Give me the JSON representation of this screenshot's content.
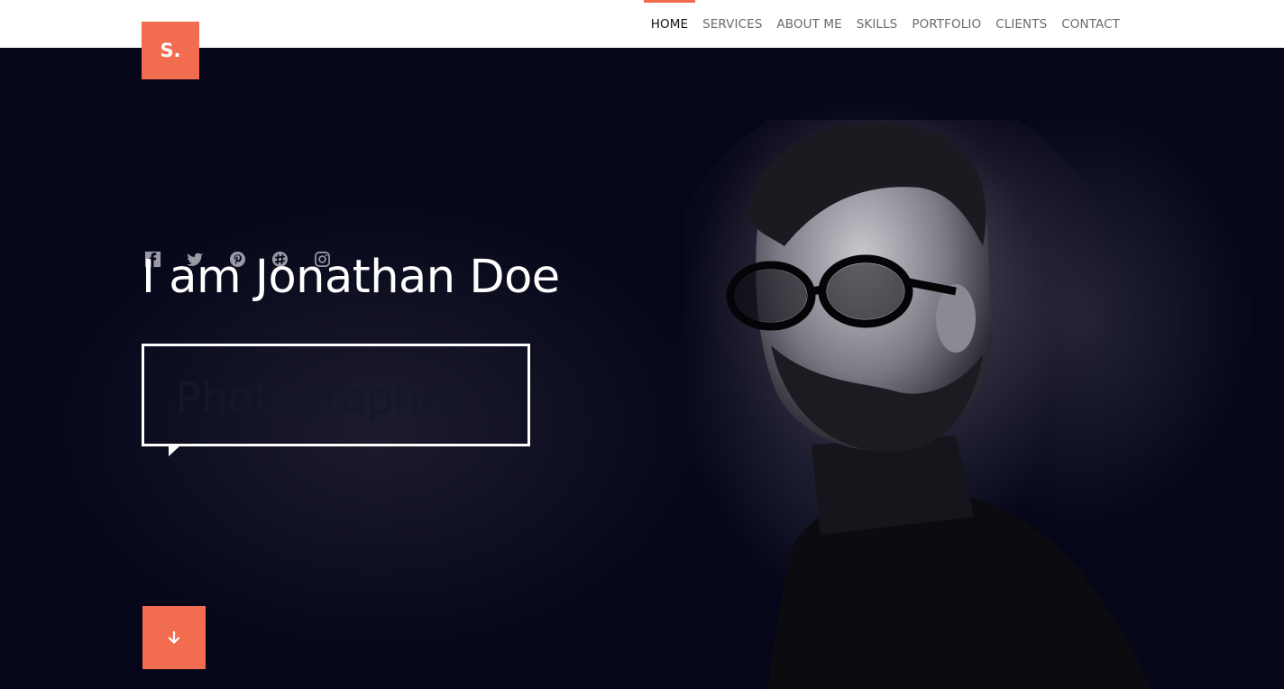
{
  "brand": {
    "logo_text": "S.",
    "accent_color": "#f26c4f"
  },
  "nav": {
    "items": [
      {
        "label": "HOME",
        "active": true
      },
      {
        "label": "SERVICES"
      },
      {
        "label": "ABOUT ME"
      },
      {
        "label": "SKILLS"
      },
      {
        "label": "PORTFOLIO"
      },
      {
        "label": "CLIENTS"
      },
      {
        "label": "CONTACT"
      }
    ]
  },
  "hero": {
    "social_icons": [
      "facebook-icon",
      "twitter-icon",
      "pinterest-icon",
      "slack-icon",
      "instagram-icon"
    ],
    "headline": "I am Jonathan Doe",
    "role": "Photographer",
    "scroll_icon": "arrow-down-icon"
  }
}
